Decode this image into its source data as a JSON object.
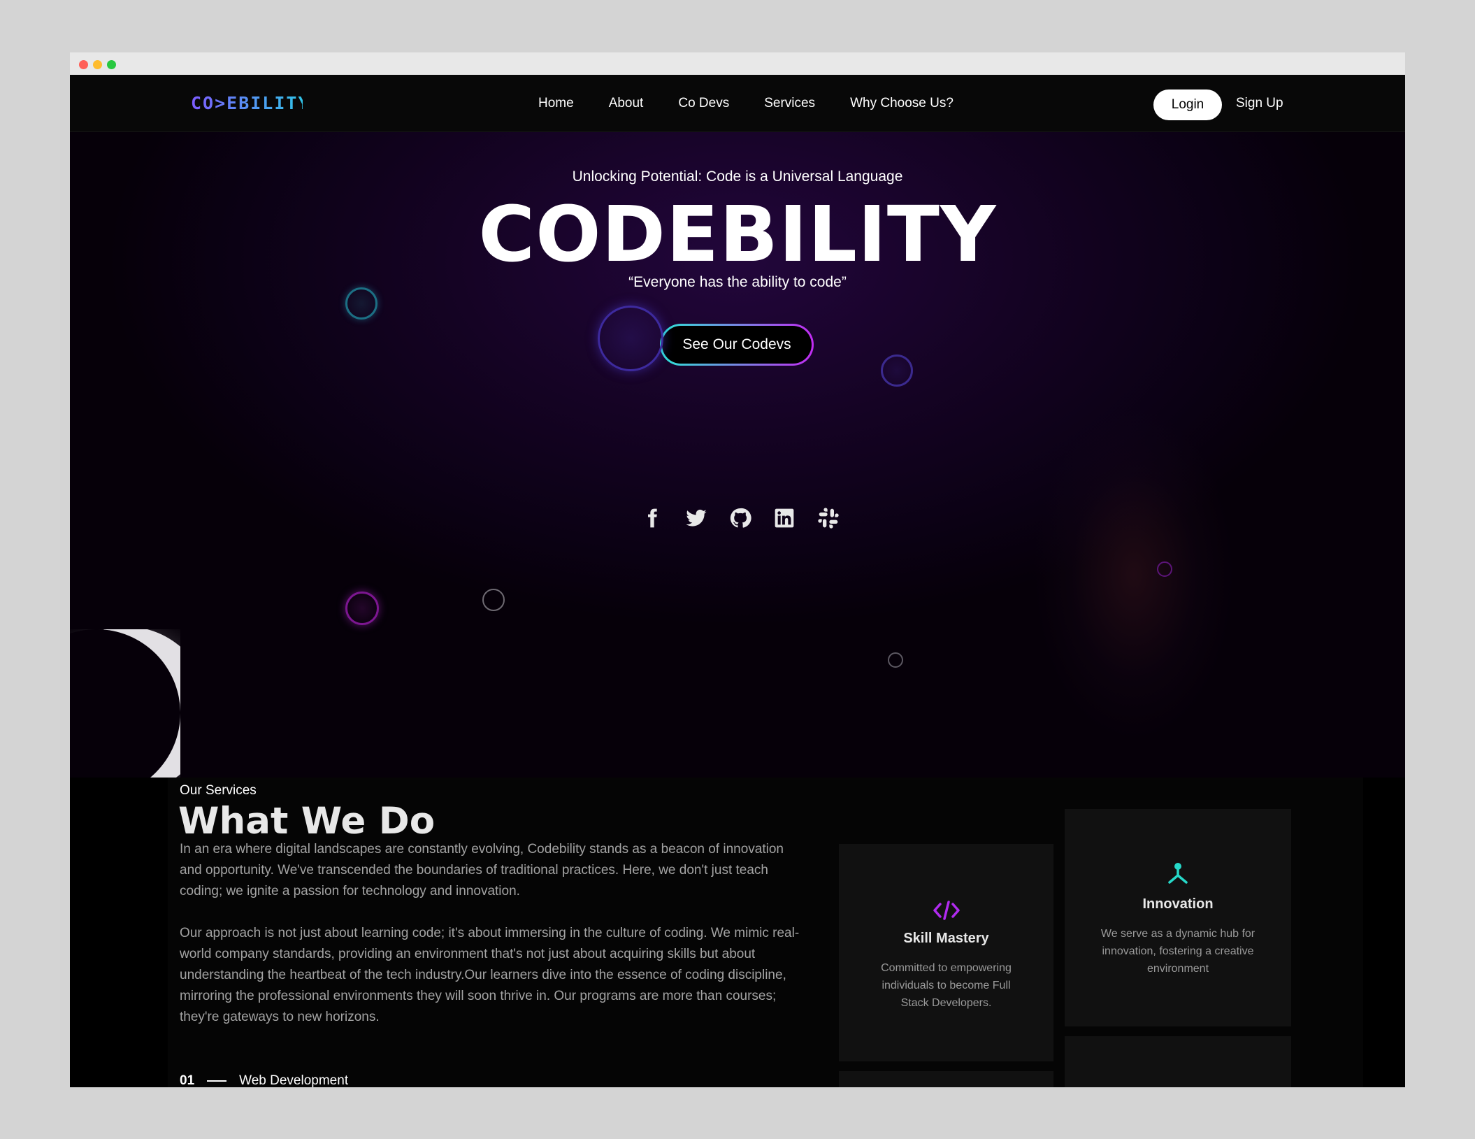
{
  "nav": {
    "logo_text": "CO>EBILITY",
    "links": [
      "Home",
      "About",
      "Co Devs",
      "Services",
      "Why Choose Us?"
    ],
    "login_label": "Login",
    "signup_label": "Sign Up"
  },
  "hero": {
    "tagline": "Unlocking Potential: Code is a Universal Language",
    "title": "CODEBILITY",
    "quote": "“Everyone has the ability to code”",
    "cta_label": "See Our Codevs"
  },
  "socials": [
    "facebook-icon",
    "twitter-icon",
    "github-icon",
    "linkedin-icon",
    "slack-icon"
  ],
  "services": {
    "label": "Our Services",
    "title": "What We Do",
    "paragraph_1": "In an era where digital landscapes are constantly evolving, Codebility stands as a beacon of innovation and opportunity. We've transcended the boundaries of traditional practices. Here, we don't just teach coding; we ignite a passion for technology and innovation.",
    "paragraph_2": "Our approach is not just about learning code; it's about immersing in the culture of coding. We mimic real-world company standards, providing an environment that's not just about acquiring skills but about understanding the heartbeat of the tech industry.Our learners dive into the essence of coding discipline, mirroring the professional environments they will soon thrive in. Our programs are more than courses; they're gateways to new horizons.",
    "list_first_number": "01",
    "list_first_label": "Web Development"
  },
  "cards": [
    {
      "icon": "code-icon",
      "title": "Skill Mastery",
      "description": "Committed to empowering individuals to become Full Stack Developers."
    },
    {
      "icon": "network-icon",
      "title": "Innovation",
      "description": "We serve as a dynamic hub for innovation, fostering a creative environment"
    }
  ],
  "colors": {
    "accent_cyan": "#2ce5d6",
    "accent_purple": "#c22bf3",
    "background": "#000000"
  }
}
